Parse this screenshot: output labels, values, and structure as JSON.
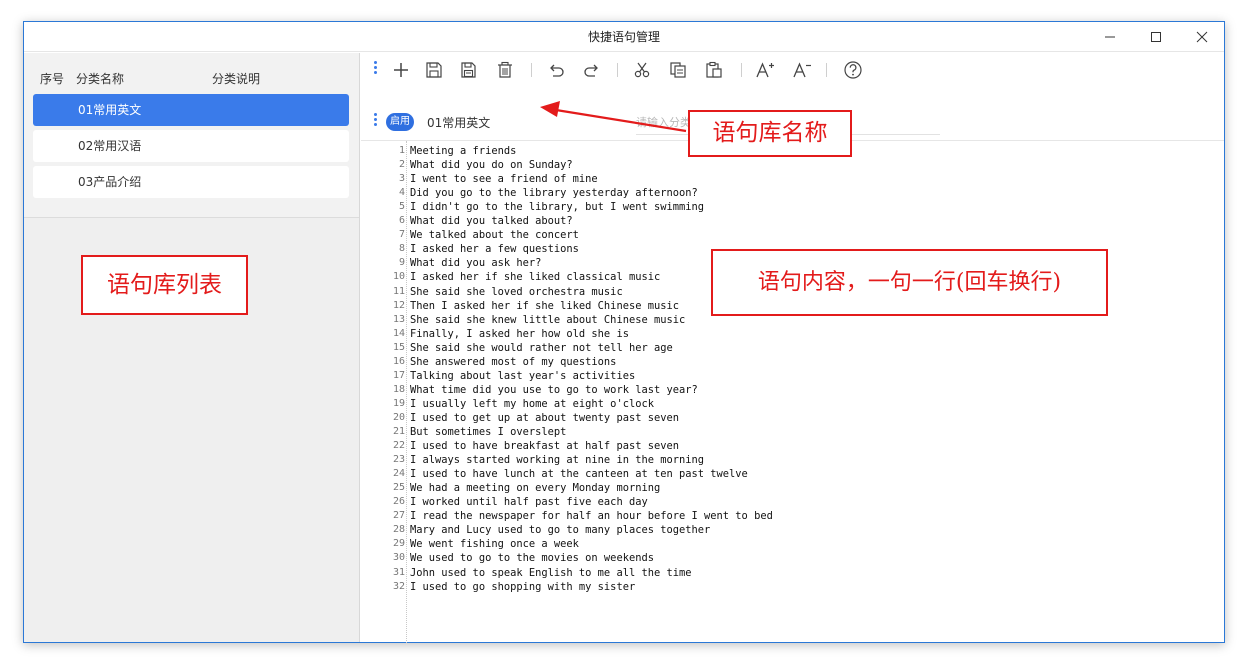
{
  "window": {
    "title": "快捷语句管理",
    "controls": [
      "minimize-icon",
      "maximize-icon",
      "close-icon"
    ]
  },
  "sidebar": {
    "columns": {
      "index": "序号",
      "name": "分类名称",
      "desc": "分类说明"
    },
    "items": [
      {
        "label": "01常用英文",
        "active": true
      },
      {
        "label": "02常用汉语",
        "active": false
      },
      {
        "label": "03产品介绍",
        "active": false
      }
    ]
  },
  "toolbar": {
    "icons": [
      "add-icon",
      "save-icon",
      "save-all-icon",
      "delete-icon",
      "undo-icon",
      "redo-icon",
      "cut-icon",
      "copy-icon",
      "paste-icon",
      "font-increase-icon",
      "font-decrease-icon",
      "help-icon"
    ]
  },
  "category": {
    "enabled_label": "启用",
    "name_value": "01常用英文",
    "desc_placeholder": "请输入分类说明"
  },
  "editor": {
    "lines": [
      "Meeting a friends",
      "What did you do on Sunday?",
      "I went to see a friend of mine",
      "Did you go to the library yesterday afternoon?",
      "I didn't go to the library, but I went swimming",
      "What did you talked about?",
      "We talked about the concert",
      "I asked her a few questions",
      "What did you ask her?",
      "I asked her if she liked classical music",
      "She said she loved orchestra music",
      "Then I asked her if she liked Chinese music",
      "She said she knew little about Chinese music",
      "Finally, I asked her how old she is",
      "She said she would rather not tell her age",
      "She answered most of my questions",
      "Talking about last year's activities",
      "What time did you use to go to work last year?",
      "I usually left my home at eight o'clock",
      "I used to get up at about twenty past seven",
      "But sometimes I overslept",
      "I used to have breakfast at half past seven",
      "I always started working at nine in the morning",
      "I used to have lunch at the canteen at ten past twelve",
      "We had a meeting on every Monday morning",
      "I worked until half past five each day",
      "I read the newspaper for half an hour before I went to bed",
      "Mary and Lucy used to go to many places together",
      "We went fishing once a week",
      "We used to go to the movies on weekends",
      "John used to speak English to me all the time",
      "I used to go shopping with my sister"
    ]
  },
  "annotations": {
    "library_name": "语句库名称",
    "library_list": "语句库列表",
    "content_note": "语句内容，一句一行(回车换行)",
    "color": "#e31b1b"
  },
  "colors": {
    "accent": "#3a7bea",
    "window_border": "#2b78d6"
  }
}
